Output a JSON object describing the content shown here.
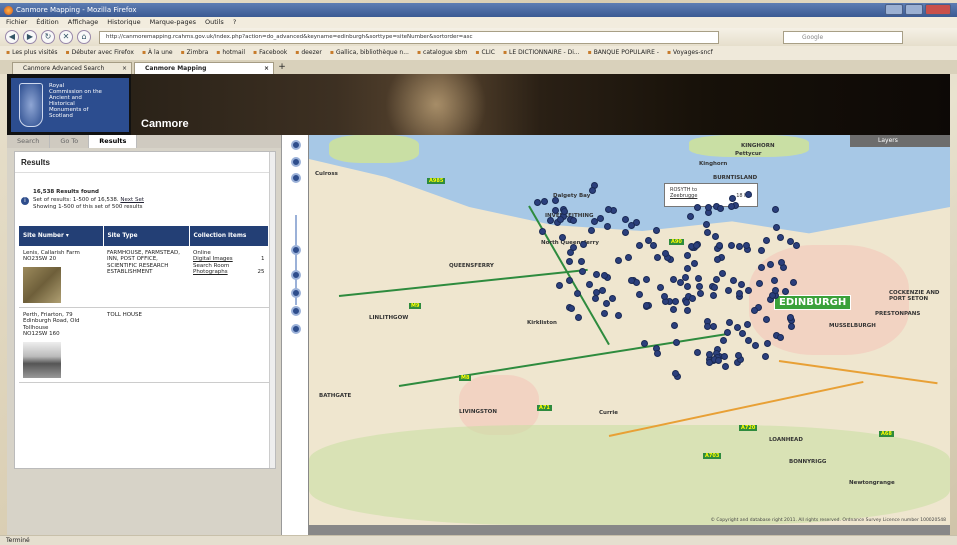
{
  "browser": {
    "title": "Canmore Mapping - Mozilla Firefox",
    "menu": [
      "Fichier",
      "Édition",
      "Affichage",
      "Historique",
      "Marque-pages",
      "Outils",
      "?"
    ],
    "url": "http://canmoremapping.rcahms.gov.uk/index.php?action=do_advanced&keyname=edinburgh&sorttype=siteNumber&sortorder=asc",
    "search_placeholder": "Google",
    "bookmarks": [
      "Les plus visités",
      "Débuter avec Firefox",
      "À la une",
      "Zimbra",
      "hotmail",
      "Facebook",
      "deezer",
      "Gallica, bibliothèque n...",
      "catalogue sbm",
      "CLIC",
      "LE DICTIONNAIRE - Di...",
      "BANQUE POPULAIRE -",
      "Voyages-sncf"
    ],
    "tabs": [
      {
        "label": "Canmore Advanced Search"
      },
      {
        "label": "Canmore Mapping"
      }
    ],
    "new_tab": "+",
    "status": "Terminé"
  },
  "header": {
    "logo_lines": [
      "Royal",
      "Commission on the",
      "Ancient and",
      "Historical",
      "Monuments of",
      "Scotland"
    ],
    "brand": "Canmore"
  },
  "left_tabs": [
    "Search",
    "Go To",
    "Results"
  ],
  "results": {
    "title": "Results",
    "found": "16,538 Results found",
    "set_line": "Set of results: 1-500 of 16,538.",
    "next_set": "Next Set",
    "showing": "Showing 1-500 of this set of 500 results",
    "columns": [
      "Site Number ▾",
      "Site Type",
      "Collection Items"
    ],
    "rows": [
      {
        "name": "Lenis, Callarish Farm",
        "number": "NO23SW 20",
        "type": "FARMHOUSE, FARMSTEAD, INN, POST OFFICE, SCIENTIFIC RESEARCH ESTABLISHMENT",
        "items": [
          {
            "label": "Online",
            "count": ""
          },
          {
            "label": "Digital Images",
            "count": "1"
          },
          {
            "label": "Search Room",
            "count": ""
          },
          {
            "label": "Photographs",
            "count": "25"
          }
        ]
      },
      {
        "name": "Perth, Friarton, 79 Edinburgh Road, Old Tollhouse",
        "number": "NO12SW 160",
        "type": "TOLL HOUSE",
        "items": []
      }
    ]
  },
  "map": {
    "layers_label": "Layers",
    "city": "EDINBURGH",
    "ferry_route": "ROSYTH to",
    "ferry_dest": "Zeebrugge",
    "ferry_time": "18 hrs",
    "places": [
      "KINGHORN",
      "BURNTISLAND",
      "Culross",
      "INVERKEITHING",
      "North Queensferry",
      "LINLITHGOW",
      "QUEENSFERRY",
      "LIVINGSTON",
      "Kirkliston",
      "Currie",
      "LOANHEAD",
      "BONNYRIGG",
      "COCKENZIE AND PORT SETON",
      "PRESTONPANS",
      "MUSSELBURGH",
      "Pettycur",
      "Kinghorn",
      "Dalgety Bay",
      "BATHGATE",
      "Newtongrange"
    ],
    "roads": [
      "A985",
      "A90",
      "A71",
      "A720",
      "A703",
      "A68",
      "M8",
      "M9"
    ],
    "copyright": "© Copyright and database right 2011. All rights reserved. Ordnance Survey Licence number 100020548"
  },
  "colors": {
    "navy": "#233f75",
    "pin": "#2b3f7c",
    "map_bg": "#efe6cf",
    "water": "#a7c8e6",
    "edinburgh_label": "#3aa13a"
  }
}
